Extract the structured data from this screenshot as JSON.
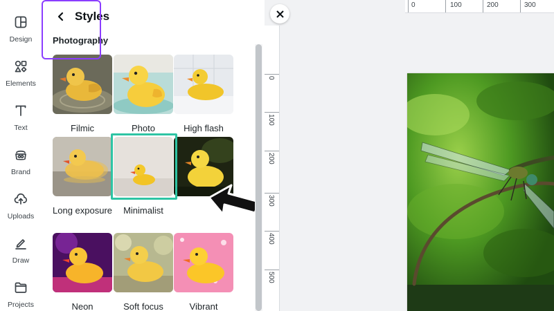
{
  "rail": {
    "items": [
      {
        "label": "Design",
        "icon": "design-icon"
      },
      {
        "label": "Elements",
        "icon": "elements-icon"
      },
      {
        "label": "Text",
        "icon": "text-icon"
      },
      {
        "label": "Brand",
        "icon": "brand-icon"
      },
      {
        "label": "Uploads",
        "icon": "uploads-icon"
      },
      {
        "label": "Draw",
        "icon": "draw-icon"
      },
      {
        "label": "Projects",
        "icon": "projects-icon"
      }
    ]
  },
  "panel": {
    "title": "Styles",
    "section": "Photography",
    "styles": [
      {
        "label": "Filmic"
      },
      {
        "label": "Photo"
      },
      {
        "label": "High flash"
      },
      {
        "label": "Long exposure"
      },
      {
        "label": "Minimalist",
        "selected": true
      },
      {
        "label": ""
      },
      {
        "label": "Neon"
      },
      {
        "label": "Soft focus"
      },
      {
        "label": "Vibrant"
      }
    ]
  },
  "rulers": {
    "horizontal": [
      "0",
      "100",
      "200",
      "300"
    ],
    "vertical": [
      "0",
      "100",
      "200",
      "300",
      "400",
      "500"
    ]
  },
  "colors": {
    "accent": "#8b3dff",
    "highlight": "#2ec4a4"
  }
}
